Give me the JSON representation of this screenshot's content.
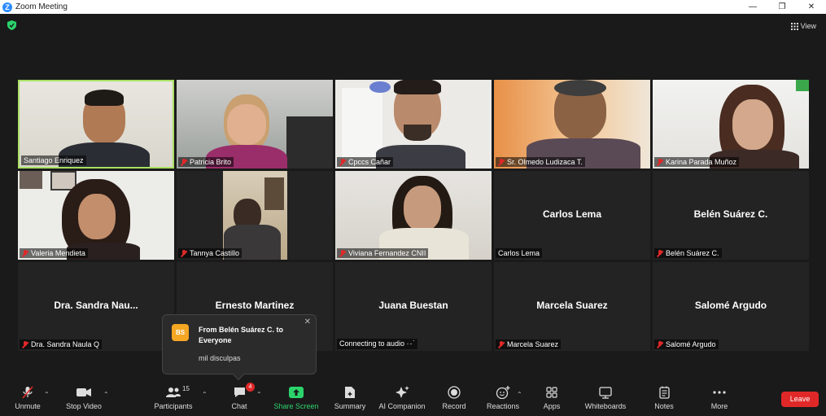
{
  "window": {
    "title": "Zoom Meeting",
    "minimize": "—",
    "restore": "❐",
    "close": "✕"
  },
  "topbar": {
    "view_label": "View"
  },
  "tiles": [
    {
      "name": "Santiago Enriquez"
    },
    {
      "name": "Patricia Brito"
    },
    {
      "name": "Cpccs Cañar"
    },
    {
      "name": "Sr. Olmedo Ludizaca T."
    },
    {
      "name": "Karina Parada Muñoz"
    },
    {
      "name": "Valeria Mendieta"
    },
    {
      "name": "Tannya Castillo"
    },
    {
      "name": "Viviana Fernandez CNII"
    },
    {
      "name": "Carlos Lema",
      "center": "Carlos Lema"
    },
    {
      "name": "Belén Suárez C.",
      "center": "Belén Suárez C."
    },
    {
      "name": "Dra. Sandra Naula Q",
      "center": "Dra. Sandra Nau..."
    },
    {
      "name": "",
      "center": "Ernesto Martinez"
    },
    {
      "name": "Connecting to audio ·٠˙",
      "center": "Juana Buestan"
    },
    {
      "name": "Marcela Suarez",
      "center": "Marcela Suarez"
    },
    {
      "name": "Salomé Argudo",
      "center": "Salomé Argudo"
    }
  ],
  "toast": {
    "initials": "BS",
    "from": "From Belén Suárez C. to Everyone",
    "message": "mil disculpas",
    "close": "✕"
  },
  "toolbar": {
    "unmute": "Unmute",
    "stop_video": "Stop Video",
    "participants": "Participants",
    "participants_count": "15",
    "chat": "Chat",
    "chat_badge": "4",
    "share_screen": "Share Screen",
    "summary": "Summary",
    "ai_companion": "AI Companion",
    "record": "Record",
    "reactions": "Reactions",
    "apps": "Apps",
    "whiteboards": "Whiteboards",
    "notes": "Notes",
    "more": "More",
    "leave": "Leave"
  }
}
